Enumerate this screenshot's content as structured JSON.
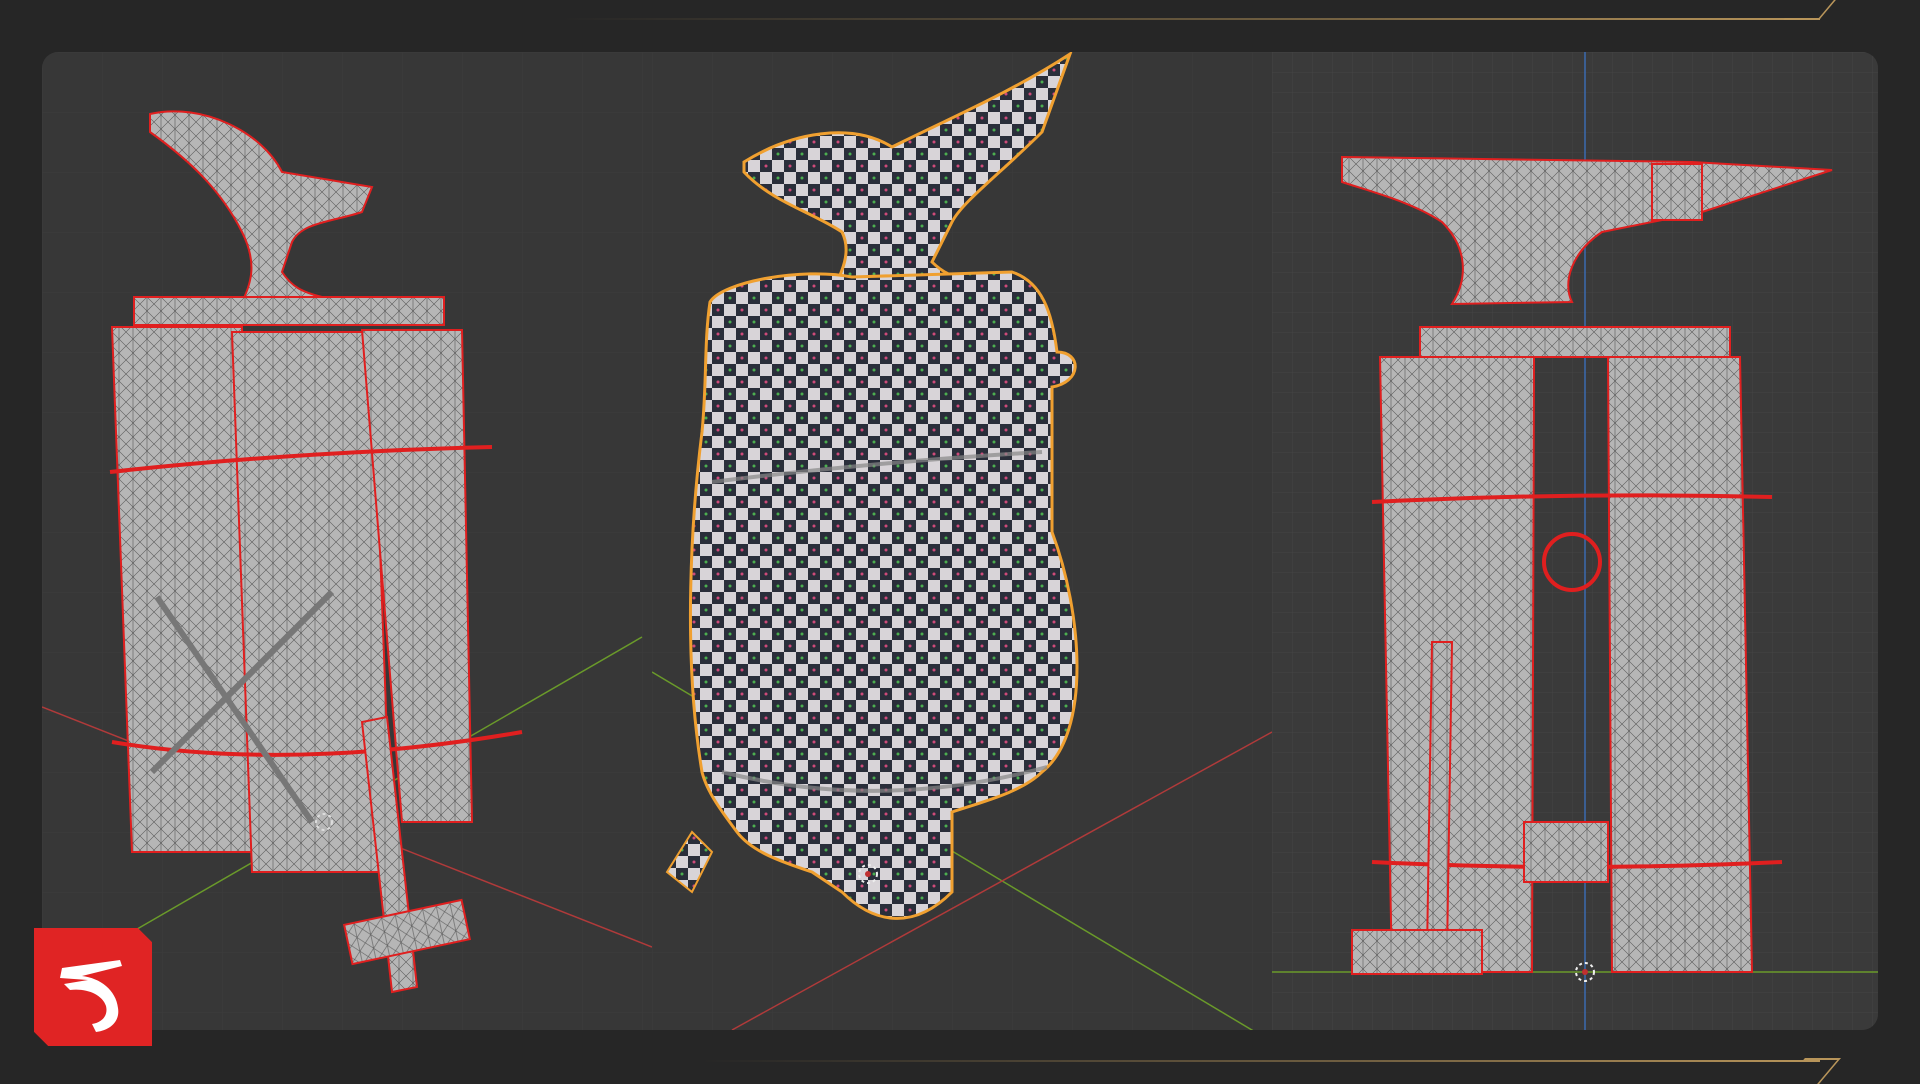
{
  "scene": {
    "views": [
      {
        "id": "perspective-left",
        "shading": "wireframe-solid",
        "selected": false
      },
      {
        "id": "perspective-center",
        "shading": "uv-checker",
        "selected": true
      },
      {
        "id": "front-orthographic",
        "shading": "wireframe-solid",
        "selected": false
      }
    ],
    "colors": {
      "background": "#262626",
      "viewport": "#373737",
      "mesh": "#b8b8b8",
      "seams": "#e01f1f",
      "selection_outline": "#f0a030",
      "checker_dark": "#2a2e3a",
      "checker_light": "#d8d4d8",
      "x_axis": "#b03a3a",
      "y_axis": "#6a9a2a",
      "z_axis": "#3a6ab0",
      "accent_frame": "#b8955a",
      "logo": "#e02424"
    },
    "icons": [
      "3d-cursor-icon",
      "studio-logo-icon"
    ]
  }
}
